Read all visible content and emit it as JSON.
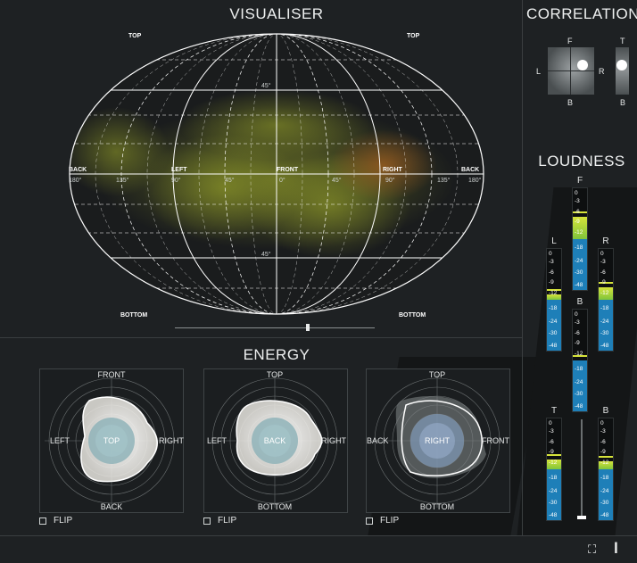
{
  "visualiser": {
    "title": "VISUALISER",
    "labels": {
      "top_left": "TOP",
      "top_right": "TOP",
      "bottom_left": "BOTTOM",
      "bottom_right": "BOTTOM",
      "back_left": "BACK",
      "left": "LEFT",
      "front": "FRONT",
      "right": "RIGHT",
      "back_right": "BACK",
      "deg_180_l": "180°",
      "deg_135_l": "135°",
      "deg_90_l": "90°",
      "deg_45_l": "45°",
      "deg_0": "0°",
      "deg_45_r": "45°",
      "deg_90_r": "90°",
      "deg_135_r": "135°",
      "deg_180_r": "180°",
      "lat_top": "45°",
      "lat_bottom": "45°"
    }
  },
  "energy": {
    "title": "ENERGY",
    "panels": [
      {
        "top": "FRONT",
        "left": "LEFT",
        "right": "RIGHT",
        "bottom": "BACK",
        "center": "TOP",
        "flip": "FLIP"
      },
      {
        "top": "TOP",
        "left": "LEFT",
        "right": "RIGHT",
        "bottom": "BOTTOM",
        "center": "BACK",
        "flip": "FLIP"
      },
      {
        "top": "TOP",
        "left": "BACK",
        "right": "FRONT",
        "bottom": "BOTTOM",
        "center": "RIGHT",
        "flip": "FLIP"
      }
    ]
  },
  "correlation": {
    "title": "CORRELATION",
    "f": "F",
    "b": "B",
    "l": "L",
    "r": "R",
    "t_top": "T",
    "t_bottom": "B"
  },
  "loudness": {
    "title": "LOUDNESS",
    "scale": [
      "0",
      "-3",
      "-6",
      "-9",
      "-12",
      "-18",
      "-24",
      "-30",
      "-48"
    ],
    "meters": [
      {
        "label": "F",
        "level": 0.72
      },
      {
        "label": "L",
        "level": 0.55
      },
      {
        "label": "R",
        "level": 0.62
      },
      {
        "label": "B",
        "level": 0.5
      },
      {
        "label": "T",
        "level": 0.6
      },
      {
        "label": "B",
        "level": 0.58
      }
    ]
  },
  "colors": {
    "accent_yellow": "#d6e33a",
    "meter_green": "#7fc43b",
    "meter_blue": "#1e7fb8",
    "background": "#1e2123"
  }
}
